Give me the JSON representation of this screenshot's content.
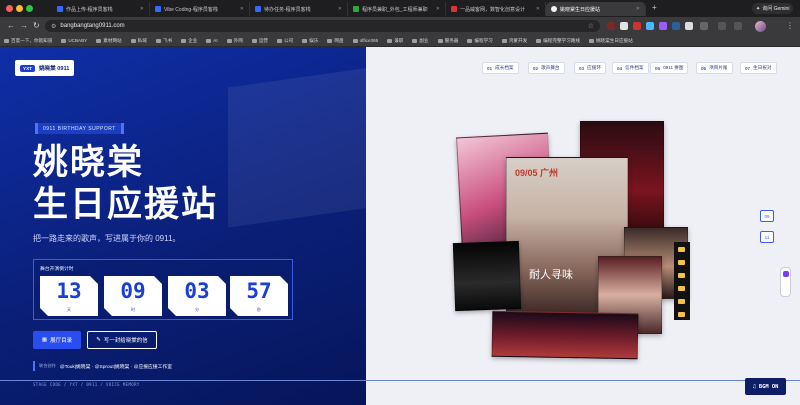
{
  "browser": {
    "tabs": [
      {
        "label": "作品上传-程序员客栈",
        "color": "#2f6bff"
      },
      {
        "label": "Vibe Coding-程序员客栈",
        "color": "#2f6bff"
      },
      {
        "label": "待办任务-程序员客栈",
        "color": "#2f6bff"
      },
      {
        "label": "程序员兼职_外包_工程师兼职",
        "color": "#2aa83a"
      },
      {
        "label": "一品威客网，数智化创意设计",
        "color": "#e0303a"
      },
      {
        "label": "姚晓棠生日应援站",
        "color": "#f2f2f2"
      }
    ],
    "gemini_label": "询问 Gemini",
    "url": "bangbangtang0911.com",
    "bookmarks": [
      "百度一下，你就知道",
      "UCBABY",
      "素材网站",
      "私域",
      "飞书",
      "企业",
      "AI",
      "外网",
      "运营",
      "公司",
      "娱乐",
      "网盘",
      "office365",
      "兼职",
      "副业",
      "服务器",
      "编程学习",
      "鸿蒙开发",
      "编程完整学习路线",
      "姚晓棠生日应援站"
    ]
  },
  "page": {
    "brand_tag": "YXT",
    "brand_name": "姚晓棠 0911",
    "kicker": "0911 BIRTHDAY SUPPORT",
    "title_line1": "姚晓棠",
    "title_line2": "生日应援站",
    "subtitle": "把一路走来的歌声，写进属于你的 0911。",
    "countdown": {
      "label": "舞台开演倒计时",
      "cells": [
        {
          "value": "13",
          "unit": "天"
        },
        {
          "value": "09",
          "unit": "时"
        },
        {
          "value": "03",
          "unit": "分"
        },
        {
          "value": "57",
          "unit": "秒"
        }
      ]
    },
    "primary_button": "展厅目录",
    "outline_button": "写一封给晓棠的信",
    "credits_label": "联合创作",
    "credits_value": "@Touk|姚晓棠 · @Sprout|姚晓棠 · @应援应援工作室",
    "footer_code": "STAGE CODE / YXT / 0911 / VOICE MEMORY",
    "nav": [
      {
        "num": "01",
        "label": "成长档案"
      },
      {
        "num": "02",
        "label": "歌声舞台"
      },
      {
        "num": "03",
        "label": "应援环"
      },
      {
        "num": "04",
        "label": "信件档案"
      },
      {
        "num": "05",
        "label": "0911 拼图"
      },
      {
        "num": "06",
        "label": "项目片尾"
      },
      {
        "num": "07",
        "label": "生日祝对"
      }
    ],
    "pager": [
      "09",
      "11"
    ],
    "bgm_label": "BGM ON",
    "poster_text": "09/05 广州",
    "poster_script": "耐人寻味"
  }
}
